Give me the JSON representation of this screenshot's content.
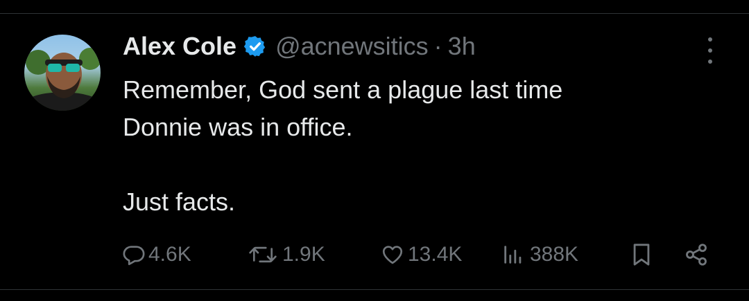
{
  "tweet": {
    "author_name": "Alex Cole",
    "handle": "@acnewsitics",
    "separator": "·",
    "time": "3h",
    "lines": [
      "Remember, God sent a plague last time",
      "Donnie was in office.",
      "Just facts."
    ]
  },
  "metrics": {
    "replies": "4.6K",
    "reposts": "1.9K",
    "likes": "13.4K",
    "views": "388K"
  },
  "icons": {
    "verified": "verified-badge-icon",
    "more": "more-vertical-icon",
    "reply": "reply-icon",
    "repost": "repost-icon",
    "like": "heart-icon",
    "views": "views-chart-icon",
    "bookmark": "bookmark-icon",
    "share": "share-icon"
  },
  "colors": {
    "background": "#000000",
    "text": "#e7e9ea",
    "muted": "#71767b",
    "verified": "#1d9bf0"
  }
}
